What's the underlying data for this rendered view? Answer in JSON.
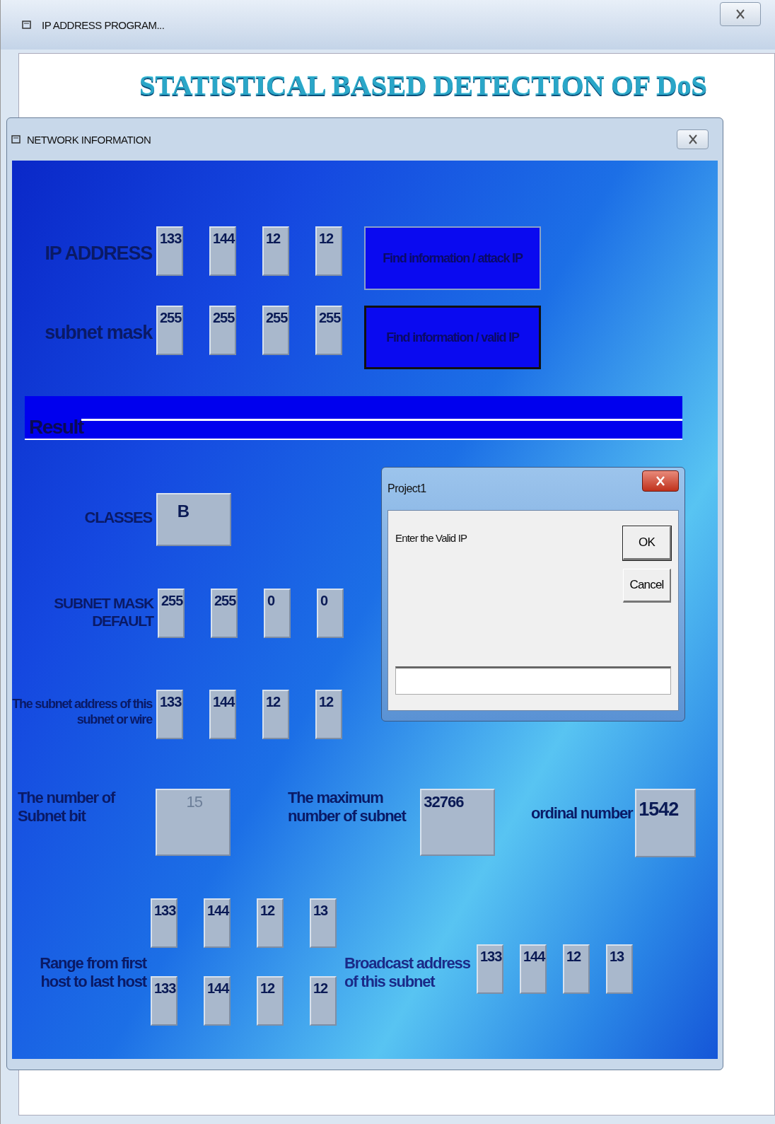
{
  "main_window": {
    "title": "IP ADDRESS PROGRAM...",
    "banner": "STATISTICAL BASED DETECTION OF DoS"
  },
  "network_window": {
    "title": "NETWORK INFORMATION"
  },
  "inputs": [
    {
      "label": "IP ADDRESS",
      "octets": [
        "133",
        "144",
        "12",
        "12"
      ],
      "button": {
        "label": "Find information / attack IP",
        "focused": false
      }
    },
    {
      "label": "subnet mask",
      "octets": [
        "255",
        "255",
        "255",
        "255"
      ],
      "button": {
        "label": "Find information / valid IP",
        "focused": true
      }
    }
  ],
  "result_heading": "Result",
  "classes": {
    "label": "CLASSES",
    "value": "B"
  },
  "subnet_mask_default": {
    "label": "SUBNET MASK DEFAULT",
    "octets": [
      "255",
      "255",
      "0",
      "0"
    ]
  },
  "subnet_address": {
    "label": "The subnet address of this subnet or wire",
    "octets": [
      "133",
      "144",
      "12",
      "12"
    ]
  },
  "subnet_bits": {
    "label": "The number of Subnet bit",
    "value": "15",
    "disabled": true
  },
  "max_subnets": {
    "label": "The maximum number of subnet",
    "value": "32766"
  },
  "ordinal": {
    "label": "ordinal number",
    "value": "1542"
  },
  "host_range": {
    "label": "Range from first host to last host",
    "first": [
      "133",
      "144",
      "12",
      "13"
    ],
    "last": [
      "133",
      "144",
      "12",
      "12"
    ]
  },
  "broadcast": {
    "label": "Broadcast address of this subnet",
    "octets": [
      "133",
      "144",
      "12",
      "13"
    ]
  },
  "dialog": {
    "title": "Project1",
    "prompt": "Enter the Valid IP",
    "buttons": [
      {
        "label": "OK",
        "default": true
      },
      {
        "label": "Cancel",
        "default": false
      }
    ]
  }
}
